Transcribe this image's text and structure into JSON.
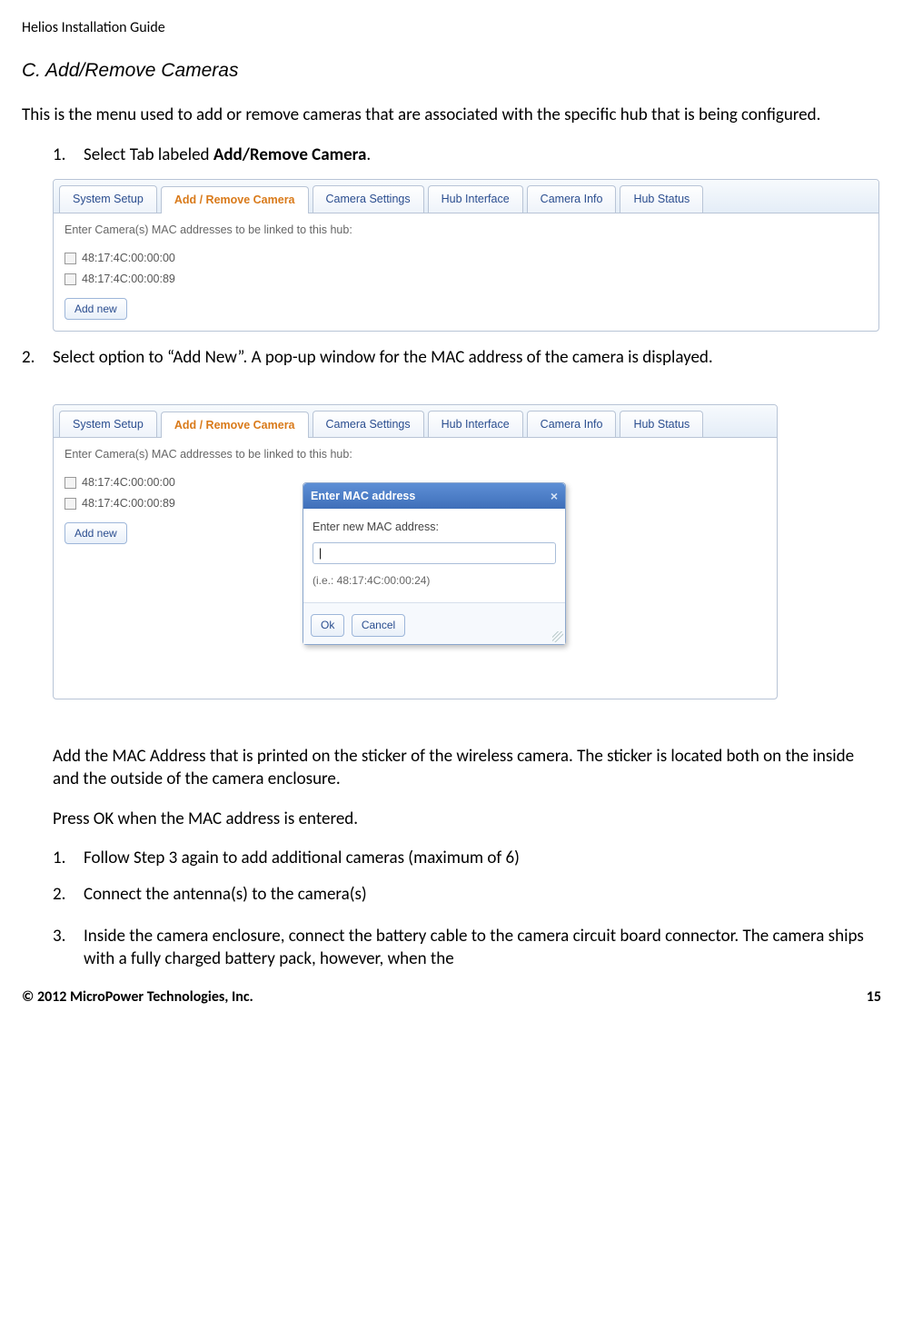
{
  "doc_header": "Helios Installation Guide",
  "section_heading": "C.  Add/Remove Cameras",
  "intro": "This is the menu used to add or remove cameras that are associated with the specific hub that is being configured.",
  "step1_num": "1.",
  "step1_pre": "Select Tab labeled ",
  "step1_bold": "Add/Remove Camera",
  "step1_post": ".",
  "tabs": {
    "t0": "System Setup",
    "t1": "Add / Remove Camera",
    "t2": "Camera Settings",
    "t3": "Hub Interface",
    "t4": "Camera Info",
    "t5": "Hub Status"
  },
  "panel": {
    "instruction": "Enter Camera(s) MAC addresses to be linked to this hub:",
    "mac0": "48:17:4C:00:00:00",
    "mac1": "48:17:4C:00:00:89",
    "add_new": "Add new"
  },
  "step2_num": "2.",
  "step2_text": "Select option to “Add New”.   A pop-up window for the MAC address of the camera is displayed.",
  "modal": {
    "title": "Enter MAC address",
    "label": "Enter new MAC address:",
    "value": "|",
    "hint": "(i.e.: 48:17:4C:00:00:24)",
    "ok": "Ok",
    "cancel": "Cancel"
  },
  "after_modal_p1": "Add the MAC Address that is printed on the sticker of the wireless camera.   The sticker is located both on the inside and the outside of the camera enclosure.",
  "after_modal_p2": "Press OK when the MAC address is entered.",
  "sub1_num": "1.",
  "sub1_text": " Follow Step 3 again to add additional cameras (maximum of 6)",
  "sub2_num": "2.",
  "sub2_text": "Connect the antenna(s) to the camera(s)",
  "sub3_num": "3.",
  "sub3_text": "Inside the camera enclosure, connect the battery cable to the camera circuit board connector. The camera ships with a fully charged battery pack, however, when the",
  "footer_left": "© 2012 MicroPower Technologies, Inc.",
  "footer_right": "15"
}
